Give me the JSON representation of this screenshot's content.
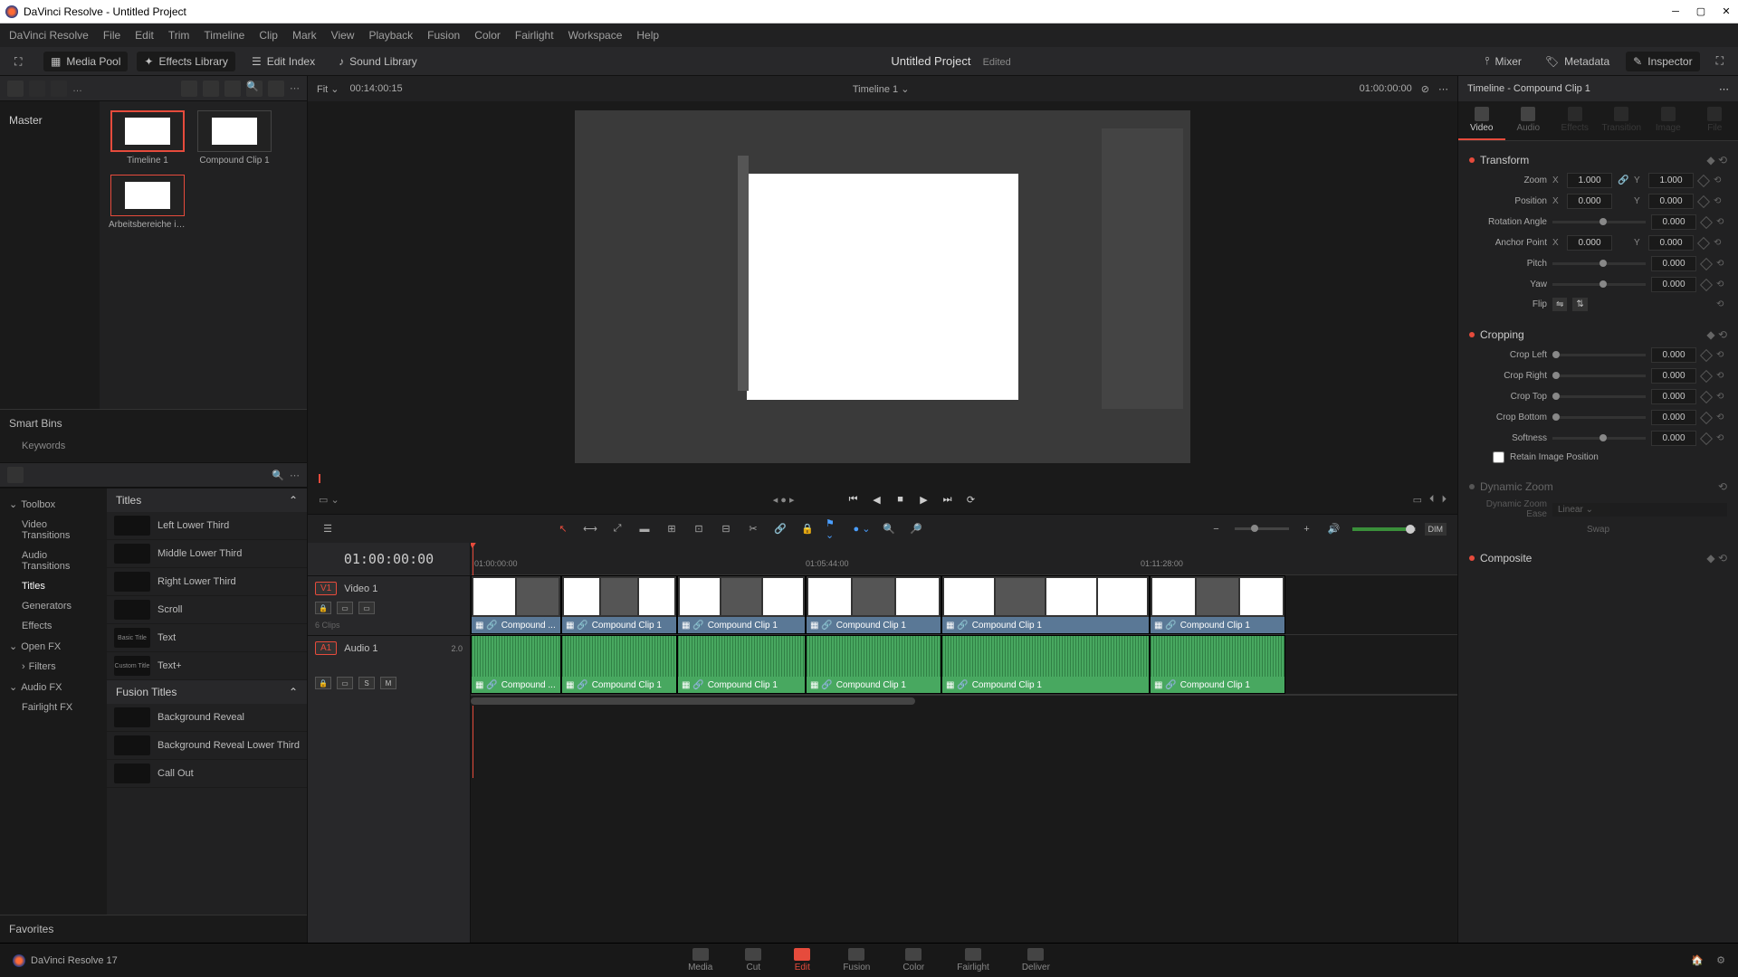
{
  "window": {
    "title": "DaVinci Resolve - Untitled Project"
  },
  "menu": [
    "DaVinci Resolve",
    "File",
    "Edit",
    "Trim",
    "Timeline",
    "Clip",
    "Mark",
    "View",
    "Playback",
    "Fusion",
    "Color",
    "Fairlight",
    "Workspace",
    "Help"
  ],
  "topbar": {
    "media_pool": "Media Pool",
    "effects_library": "Effects Library",
    "edit_index": "Edit Index",
    "sound_library": "Sound Library",
    "mixer": "Mixer",
    "metadata": "Metadata",
    "inspector": "Inspector",
    "project_title": "Untitled Project",
    "project_status": "Edited"
  },
  "media": {
    "master": "Master",
    "smart_bins": "Smart Bins",
    "keywords": "Keywords",
    "clips": [
      {
        "name": "Timeline 1",
        "selected": true
      },
      {
        "name": "Compound Clip 1",
        "selected": false
      },
      {
        "name": "Arbeitsbereiche in...",
        "selected": false
      }
    ]
  },
  "fx": {
    "toolbox": "Toolbox",
    "video_transitions": "Video Transitions",
    "audio_transitions": "Audio Transitions",
    "titles": "Titles",
    "generators": "Generators",
    "effects": "Effects",
    "open_fx": "Open FX",
    "filters": "Filters",
    "audio_fx": "Audio FX",
    "fairlight_fx": "Fairlight FX",
    "favorites": "Favorites",
    "section_titles": "Titles",
    "section_fusion": "Fusion Titles",
    "titles_list": [
      "Left Lower Third",
      "Middle Lower Third",
      "Right Lower Third",
      "Scroll",
      "Text",
      "Text+"
    ],
    "fusion_list": [
      "Background Reveal",
      "Background Reveal Lower Third",
      "Call Out"
    ]
  },
  "viewer": {
    "fit": "Fit",
    "dur": "00:14:00:15",
    "name": "Timeline 1",
    "tc": "01:00:00:00"
  },
  "timeline": {
    "timecode": "01:00:00:00",
    "video_track": "Video 1",
    "audio_track": "Audio 1",
    "v_badge": "V1",
    "a_badge": "A1",
    "clip_count": "6 Clips",
    "audio_ch": "2.0",
    "ruler": [
      "01:00:00:00",
      "01:05:44:00",
      "01:11:28:00"
    ],
    "clip_label": "Compound ...",
    "clip_label_full": "Compound Clip 1",
    "dim": "DIM"
  },
  "inspector": {
    "hdr": "Timeline - Compound Clip 1",
    "tabs": [
      "Video",
      "Audio",
      "Effects",
      "Transition",
      "Image",
      "File"
    ],
    "transform": "Transform",
    "cropping": "Cropping",
    "dynamic_zoom": "Dynamic Zoom",
    "composite": "Composite",
    "zoom": "Zoom",
    "position": "Position",
    "rotation": "Rotation Angle",
    "anchor": "Anchor Point",
    "pitch": "Pitch",
    "yaw": "Yaw",
    "flip": "Flip",
    "crop_left": "Crop Left",
    "crop_right": "Crop Right",
    "crop_top": "Crop Top",
    "crop_bottom": "Crop Bottom",
    "softness": "Softness",
    "retain": "Retain Image Position",
    "dz_ease": "Dynamic Zoom Ease",
    "linear": "Linear",
    "swap": "Swap",
    "val_1": "1.000",
    "val_0": "0.000"
  },
  "pages": [
    "Media",
    "Cut",
    "Edit",
    "Fusion",
    "Color",
    "Fairlight",
    "Deliver"
  ],
  "footer": {
    "app": "DaVinci Resolve 17"
  }
}
